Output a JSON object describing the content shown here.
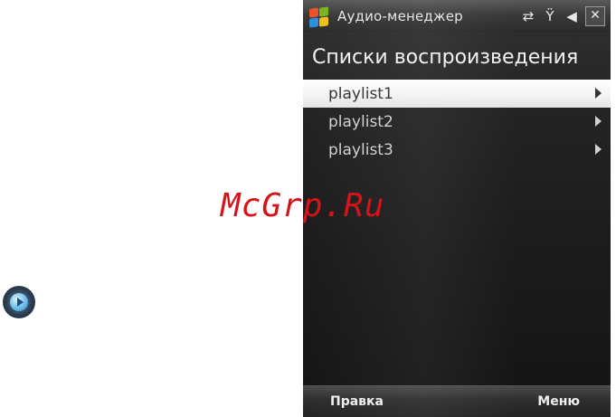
{
  "window": {
    "title": "Аудио-менеджер",
    "tray_icons": [
      "sync-arrows-icon",
      "signal-antenna-icon",
      "speaker-icon"
    ],
    "close_glyph": "✕"
  },
  "screen": {
    "heading": "Списки воспроизведения",
    "playlists": [
      {
        "label": "playlist1",
        "selected": true
      },
      {
        "label": "playlist2",
        "selected": false
      },
      {
        "label": "playlist3",
        "selected": false
      }
    ]
  },
  "softkeys": {
    "left": "Правка",
    "right": "Меню"
  },
  "overlay": {
    "watermark": "McGrp.Ru"
  },
  "colors": {
    "screen_bg": "#1b1b1b",
    "selection": "#f2f2f2",
    "watermark": "#d4141a"
  }
}
